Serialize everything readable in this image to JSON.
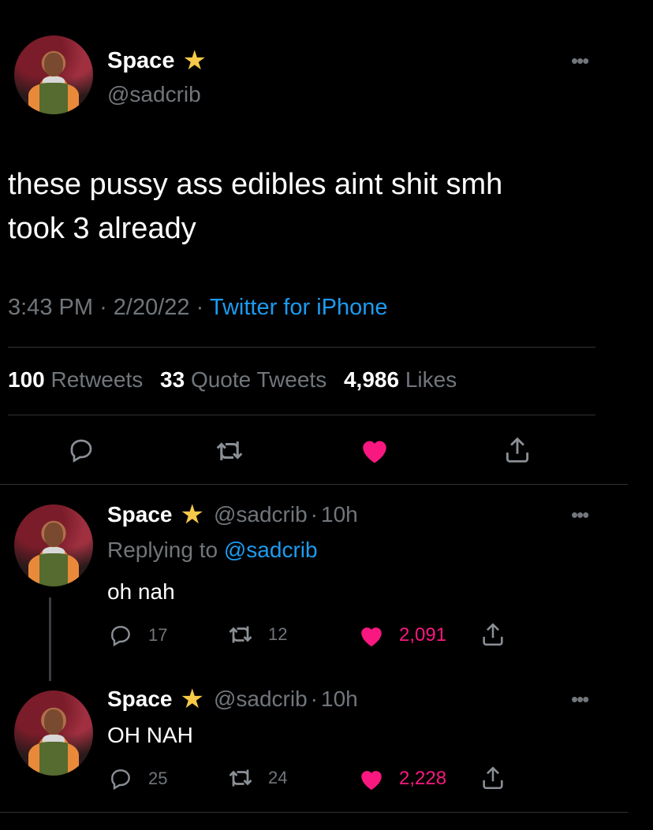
{
  "main_tweet": {
    "display_name": "Space",
    "handle": "@sadcrib",
    "text_line1": "these pussy ass edibles aint shit smh",
    "text_line2": "took 3 already",
    "time": "3:43 PM",
    "date": "2/20/22",
    "source": "Twitter for iPhone",
    "retweets_count": "100",
    "retweets_label": "Retweets",
    "quotes_count": "33",
    "quotes_label": "Quote Tweets",
    "likes_count": "4,986",
    "likes_label": "Likes"
  },
  "replies": [
    {
      "display_name": "Space",
      "handle": "@sadcrib",
      "age": "10h",
      "replying_prefix": "Replying to",
      "replying_handle": "@sadcrib",
      "text": "oh nah",
      "reply_count": "17",
      "retweet_count": "12",
      "like_count": "2,091"
    },
    {
      "display_name": "Space",
      "handle": "@sadcrib",
      "age": "10h",
      "text": "OH NAH",
      "reply_count": "25",
      "retweet_count": "24",
      "like_count": "2,228"
    }
  ],
  "separator": "·",
  "colors": {
    "background": "#000000",
    "link": "#1d9bf0",
    "like": "#f91880",
    "muted": "#71767b",
    "star": "#f7c948"
  },
  "icons": [
    "reply-icon",
    "retweet-icon",
    "heart-icon",
    "share-icon",
    "more-icon",
    "star-icon"
  ]
}
